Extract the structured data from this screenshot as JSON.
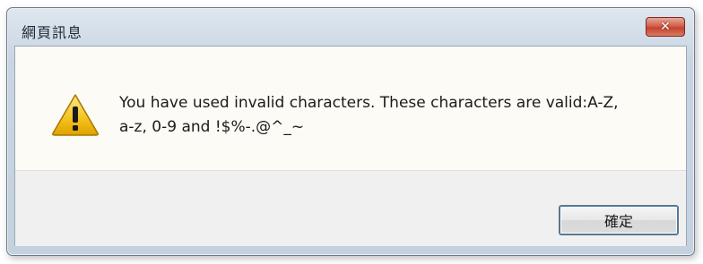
{
  "window": {
    "title": "網頁訊息",
    "close_icon": "close-icon"
  },
  "message": {
    "icon": "warning-icon",
    "text": "You have used invalid characters. These characters are valid:A-Z,\na-z, 0-9 and !$%-.@^_~"
  },
  "buttons": {
    "ok_label": "確定"
  },
  "colors": {
    "close_button": "#c24430",
    "warning_fill": "#f4c21c",
    "button_focus": "#3c7fb1"
  }
}
